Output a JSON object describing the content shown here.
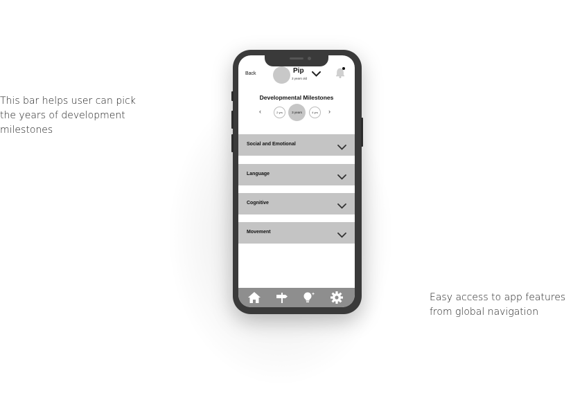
{
  "annotations": {
    "left": "This bar helps user can pick the years of development milestones",
    "right": "Easy access to app features from global navigation"
  },
  "header": {
    "back_label": "Back",
    "child_name": "Pip",
    "child_age": "3 years old"
  },
  "page_title": "Developmental Milestones",
  "year_picker": {
    "prev": "‹",
    "next": "›",
    "options": [
      "2 yrs",
      "3 years",
      "4 yrs"
    ],
    "selected": "3 years"
  },
  "sections": [
    {
      "label": "Social and Emotional"
    },
    {
      "label": "Language"
    },
    {
      "label": "Cognitive"
    },
    {
      "label": "Movement"
    }
  ],
  "nav": {
    "items": [
      "home-icon",
      "signpost-icon",
      "lightbulb-icon",
      "gear-icon"
    ]
  },
  "colors": {
    "section_bg": "#c4c4c4",
    "navbar_bg": "#8e8e8e",
    "phone_frame": "#3a3a3a"
  }
}
